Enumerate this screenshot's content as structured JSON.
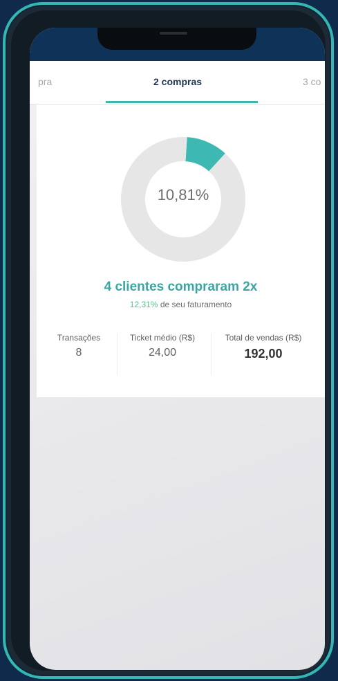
{
  "tabs": {
    "prev_label": "pra",
    "active_label": "2 compras",
    "next_label": "3 co"
  },
  "chart_data": {
    "type": "pie",
    "slices": [
      {
        "label": "",
        "value": 10.81,
        "color": "#3db8b2"
      },
      {
        "label": "",
        "value": 89.19,
        "color": "#e6e6e6"
      }
    ],
    "center_label": "10,81%"
  },
  "summary": {
    "headline": "4 clientes compraram 2x",
    "revenue_percent": "12,31%",
    "revenue_text": " de seu faturamento"
  },
  "stats": {
    "transactions_label": "Transações",
    "transactions_value": "8",
    "ticket_label": "Ticket médio (R$)",
    "ticket_value": "24,00",
    "total_label": "Total de vendas (R$)",
    "total_value": "192,00"
  },
  "colors": {
    "accent": "#3aa6a2",
    "status_bar": "#0f3358",
    "frame": "#35b7b1"
  }
}
